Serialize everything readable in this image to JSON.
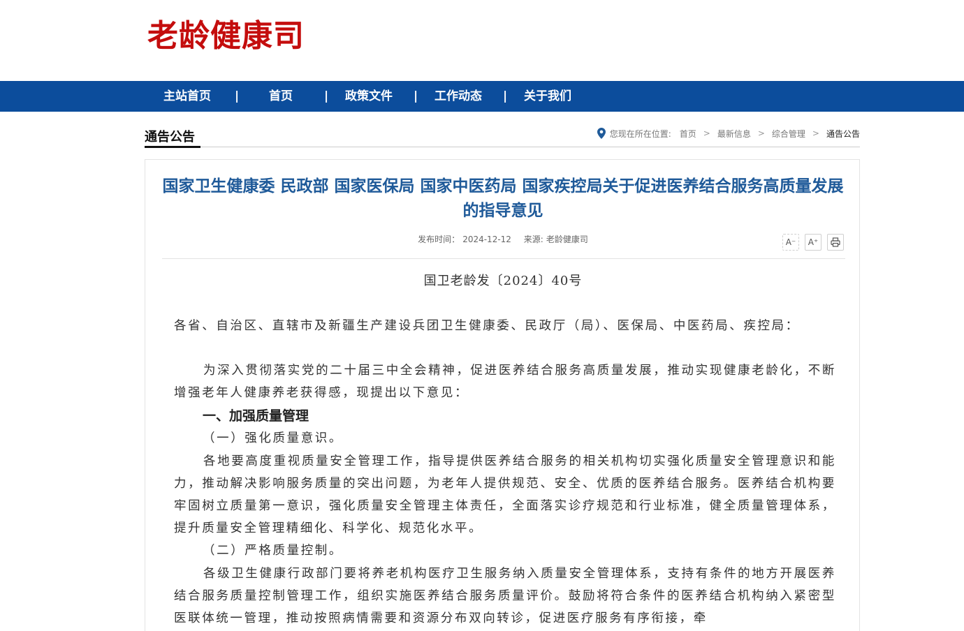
{
  "header": {
    "logo_text": "老龄健康司"
  },
  "nav": {
    "items": [
      "主站首页",
      "首页",
      "政策文件",
      "工作动态",
      "关于我们"
    ],
    "separator": "|"
  },
  "section": {
    "title": "通告公告"
  },
  "breadcrumb": {
    "prefix": "您现在所在位置:",
    "items": [
      "首页",
      "最新信息",
      "综合管理",
      "通告公告"
    ],
    "chevron": ">"
  },
  "article": {
    "title": "国家卫生健康委 民政部 国家医保局 国家中医药局 国家疾控局关于促进医养结合服务高质量发展的指导意见",
    "publish_label": "发布时间：",
    "publish_date": "2024-12-12",
    "source_label": "来源:",
    "source": "老龄健康司",
    "doc_number": "国卫老龄发〔2024〕40号",
    "addressee": "各省、自治区、直辖市及新疆生产建设兵团卫生健康委、民政厅（局）、医保局、中医药局、疾控局：",
    "intro": "为深入贯彻落实党的二十届三中全会精神，促进医养结合服务高质量发展，推动实现健康老龄化，不断增强老年人健康养老获得感，现提出以下意见：",
    "heading_1": "一、加强质量管理",
    "sub_1": "（一）强化质量意识。",
    "para_1": "各地要高度重视质量安全管理工作，指导提供医养结合服务的相关机构切实强化质量安全管理意识和能力，推动解决影响服务质量的突出问题，为老年人提供规范、安全、优质的医养结合服务。医养结合机构要牢固树立质量第一意识，强化质量安全管理主体责任，全面落实诊疗规范和行业标准，健全质量管理体系，提升质量安全管理精细化、科学化、规范化水平。",
    "sub_2": "（二）严格质量控制。",
    "para_2": "各级卫生健康行政部门要将养老机构医疗卫生服务纳入质量安全管理体系，支持有条件的地方开展医养结合服务质量控制管理工作，组织实施医养结合服务质量评价。鼓励将符合条件的医养结合机构纳入紧密型医联体统一管理，推动按照病情需要和资源分布双向转诊，促进医疗服务有序衔接，牵"
  },
  "tools": {
    "font_smaller_label": "A⁻",
    "font_larger_label": "A⁺",
    "print_icon": "printer-icon"
  },
  "colors": {
    "logo": "#c40d0d",
    "nav_bg": "#0c4d9c",
    "title": "#1f5a99"
  }
}
